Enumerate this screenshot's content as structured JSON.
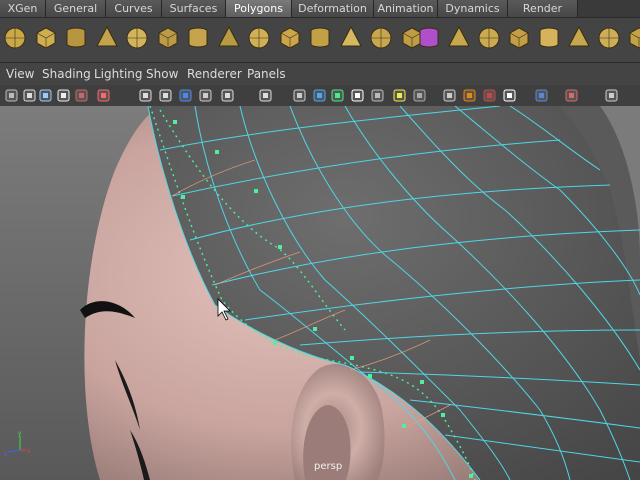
{
  "shelf_tabs": [
    "XGen",
    "General",
    "Curves",
    "Surfaces",
    "Polygons",
    "Deformation",
    "Animation",
    "Dynamics",
    "Render"
  ],
  "active_tab": "Polygons",
  "shelf_icons": [
    "sphere-icon",
    "cube-icon",
    "cylinder-icon",
    "cone-icon",
    "plane-icon",
    "torus-icon",
    "pyramid-icon",
    "pipe-icon",
    "soccer-ball-icon",
    "combine-icon",
    "separate-icon",
    "extract-icon",
    "smooth-icon",
    "boolean-icon",
    "poly-cube-icon",
    "extrude-icon",
    "split-icon",
    "bridge-icon",
    "append-icon",
    "merge-icon",
    "bevel-icon",
    "uv-icon"
  ],
  "viewport_menu": [
    "View",
    "Shading",
    "Lighting",
    "Show",
    "Renderer",
    "Panels"
  ],
  "viewport_icons": [
    "select-camera-icon",
    "camera-attributes-icon",
    "bookmark-icon",
    "image-plane-icon",
    "2d-pan-icon",
    "grease-pencil-icon",
    "grid-icon",
    "film-gate-icon",
    "resolution-gate-icon",
    "gate-mask-icon",
    "field-chart-icon",
    "safe-action-icon",
    "wireframe-icon",
    "smooth-shade-icon",
    "wireframe-on-shaded-icon",
    "xray-icon",
    "textured-icon",
    "use-lights-icon",
    "shadows-icon",
    "ambient-occlusion-icon",
    "motion-blur-icon",
    "anti-aliasing-icon",
    "isolate-select-icon",
    "xray-joints-icon",
    "xray-active-icon",
    "hud-icon"
  ],
  "camera_label": "persp",
  "colors": {
    "wireframe": "#4fd6e6",
    "selection_edge": "#4ef0a0",
    "skin": "#d9b3ad",
    "dark_mesh": "#6b6b6b"
  }
}
